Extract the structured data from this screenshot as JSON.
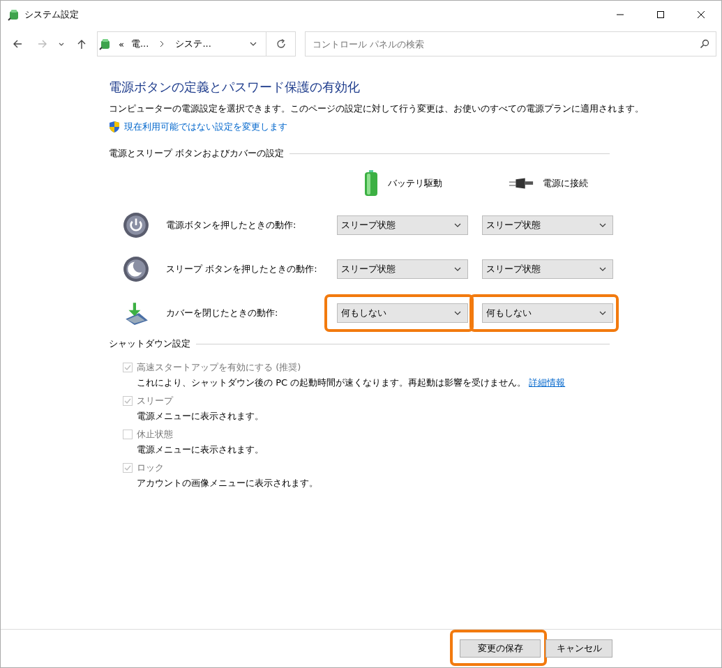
{
  "window": {
    "title": "システム設定"
  },
  "address_bar": {
    "overflow": "«",
    "crumbs": [
      "電...",
      "システ..."
    ]
  },
  "search": {
    "placeholder": "コントロール パネルの検索"
  },
  "page": {
    "heading": "電源ボタンの定義とパスワード保護の有効化",
    "description": "コンピューターの電源設定を選択できます。このページの設定に対して行う変更は、お使いのすべての電源プランに適用されます。",
    "admin_link": "現在利用可能ではない設定を変更します"
  },
  "buttons_section": {
    "title": "電源とスリープ ボタンおよびカバーの設定",
    "columns": [
      {
        "kind": "battery",
        "label": "バッテリ駆動"
      },
      {
        "kind": "plug",
        "label": "電源に接続"
      }
    ],
    "rows": [
      {
        "kind": "power",
        "label": "電源ボタンを押したときの動作:",
        "values": [
          {
            "value": "スリープ状態",
            "highlighted": false
          },
          {
            "value": "スリープ状態",
            "highlighted": false
          }
        ]
      },
      {
        "kind": "sleep",
        "label": "スリープ ボタンを押したときの動作:",
        "values": [
          {
            "value": "スリープ状態",
            "highlighted": false
          },
          {
            "value": "スリープ状態",
            "highlighted": false
          }
        ]
      },
      {
        "kind": "lid",
        "label": "カバーを閉じたときの動作:",
        "values": [
          {
            "value": "何もしない",
            "highlighted": true
          },
          {
            "value": "何もしない",
            "highlighted": true
          }
        ]
      }
    ]
  },
  "shutdown_section": {
    "title": "シャットダウン設定",
    "options": [
      {
        "label": "高速スタートアップを有効にする (推奨)",
        "description": "これにより、シャットダウン後の PC の起動時間が速くなります。再起動は影響を受けません。",
        "link": "詳細情報",
        "checked": true,
        "disabled": true
      },
      {
        "label": "スリープ",
        "description": "電源メニューに表示されます。",
        "checked": true,
        "disabled": true
      },
      {
        "label": "休止状態",
        "description": "電源メニューに表示されます。",
        "checked": false,
        "disabled": true
      },
      {
        "label": "ロック",
        "description": "アカウントの画像メニューに表示されます。",
        "checked": true,
        "disabled": true
      }
    ]
  },
  "buttons": [
    {
      "label": "変更の保存",
      "highlighted": true
    },
    {
      "label": "キャンセル",
      "highlighted": false
    }
  ]
}
